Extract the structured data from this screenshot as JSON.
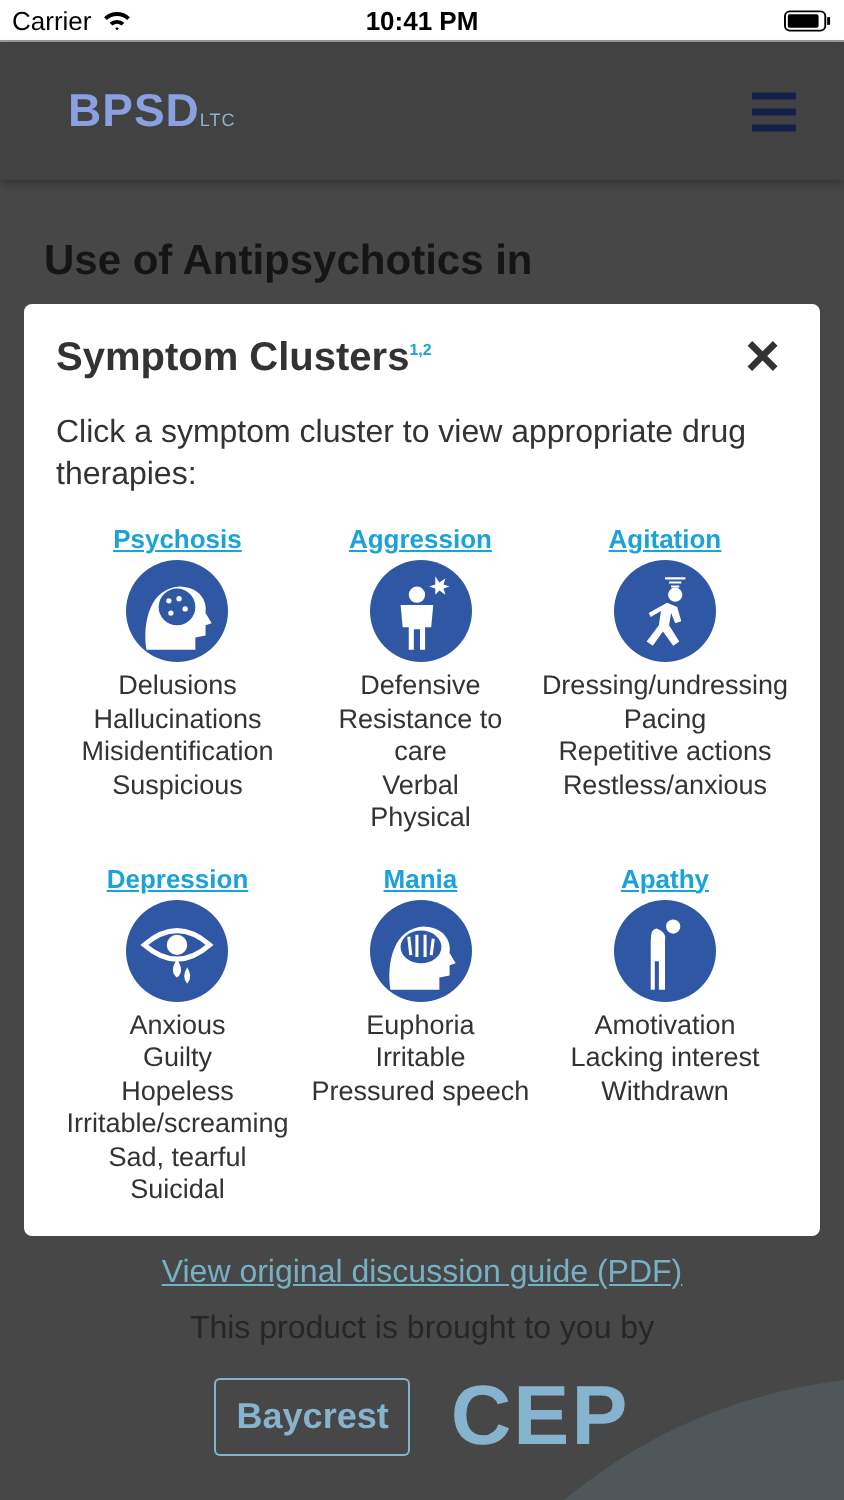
{
  "status_bar": {
    "carrier": "Carrier",
    "time": "10:41 PM"
  },
  "header": {
    "logo": "BPSD",
    "logo_suffix": "LTC"
  },
  "page": {
    "title": "Use of Antipsychotics in",
    "link": "View original discussion guide (PDF)",
    "credit": "This product is brought to you by",
    "partners": [
      "Baycrest",
      "CEP"
    ]
  },
  "modal": {
    "title": "Symptom Clusters$^{1,2}$",
    "close": "×",
    "intro": "Click a symptom cluster to view appropriate drug therapies:",
    "clusters": [
      {
        "name": "Psychosis",
        "symptoms": [
          "Delusions",
          "Hallucinations",
          "Misidentification",
          "Suspicious"
        ]
      },
      {
        "name": "Aggression",
        "symptoms": [
          "Defensive",
          "Resistance to care",
          "Verbal",
          "Physical"
        ]
      },
      {
        "name": "Agitation",
        "symptoms": [
          "Dressing/undressing",
          "Pacing",
          "Repetitive actions",
          "Restless/anxious"
        ]
      },
      {
        "name": "Depression",
        "symptoms": [
          "Anxious",
          "Guilty",
          "Hopeless",
          "Irritable/screaming",
          "Sad, tearful",
          "Suicidal"
        ]
      },
      {
        "name": "Mania",
        "symptoms": [
          "Euphoria",
          "Irritable",
          "Pressured speech"
        ]
      },
      {
        "name": "Apathy",
        "symptoms": [
          "Amotivation",
          "Lacking interest",
          "Withdrawn"
        ]
      }
    ]
  }
}
